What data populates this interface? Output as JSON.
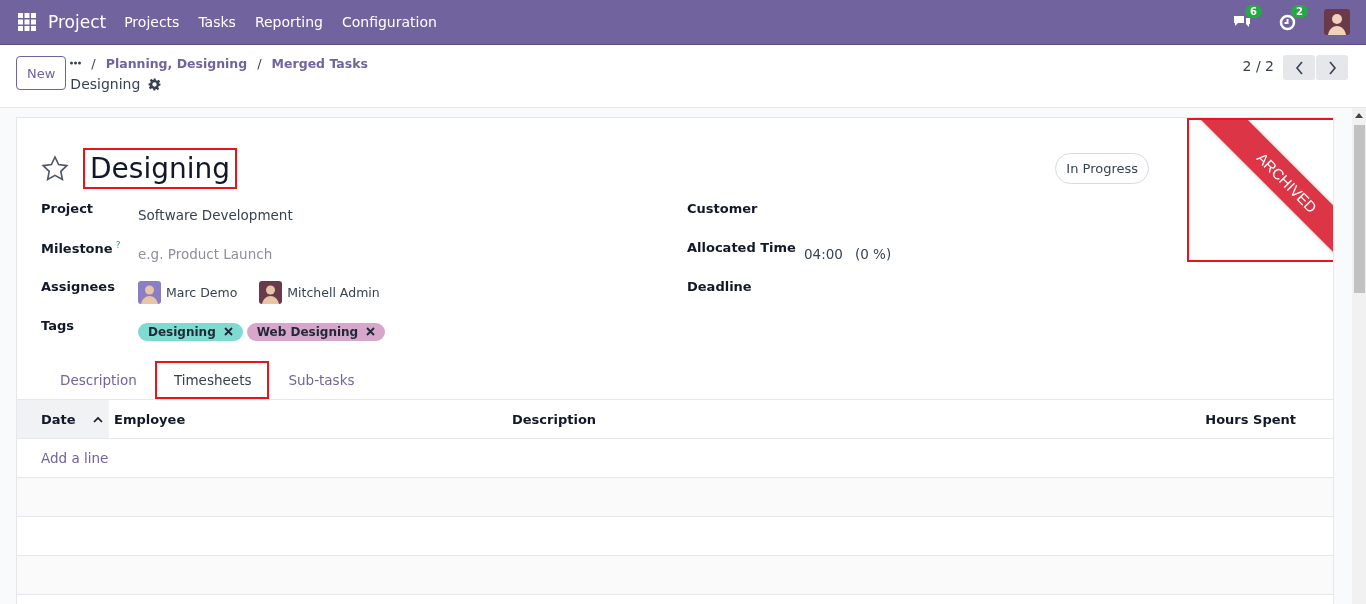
{
  "navbar": {
    "app": "Project",
    "menu": [
      "Projects",
      "Tasks",
      "Reporting",
      "Configuration"
    ],
    "messages_count": "6",
    "activities_count": "2"
  },
  "control_panel": {
    "new_button": "New",
    "breadcrumbs": [
      "Planning, Designing",
      "Merged Tasks"
    ],
    "separators": [
      "/",
      "/"
    ],
    "current": "Designing",
    "pager": "2 / 2"
  },
  "form": {
    "starred": false,
    "title": "Designing",
    "title_highlighted": true,
    "stage": "In Progress",
    "ribbon": "ARCHIVED",
    "ribbon_highlighted": true,
    "left_fields": [
      {
        "label": "Project",
        "kind": "text",
        "value": "Software Development"
      },
      {
        "label": "Milestone",
        "help": "?",
        "kind": "placeholder",
        "placeholder": "e.g. Product Launch"
      },
      {
        "label": "Assignees",
        "kind": "users",
        "users": [
          "Marc Demo",
          "Mitchell Admin"
        ]
      },
      {
        "label": "Tags",
        "kind": "tags",
        "tags": [
          {
            "name": "Designing",
            "color": "#7ddbd0"
          },
          {
            "name": "Web Designing",
            "color": "#d7a6cb"
          }
        ]
      }
    ],
    "right_fields": [
      {
        "label": "Customer",
        "kind": "text"
      },
      {
        "label": "Allocated Time",
        "kind": "time",
        "value": "04:00",
        "percent": "(0 %)"
      },
      {
        "label": "Deadline",
        "kind": "text"
      }
    ],
    "tabs": [
      {
        "label": "Description",
        "selected": false,
        "highlighted": false
      },
      {
        "label": "Timesheets",
        "selected": true,
        "highlighted": true
      },
      {
        "label": "Sub-tasks",
        "selected": false,
        "highlighted": false
      }
    ],
    "table": {
      "columns": [
        "Date",
        "Employee",
        "Description",
        "Hours Spent"
      ],
      "add_line": "Add a line"
    }
  }
}
